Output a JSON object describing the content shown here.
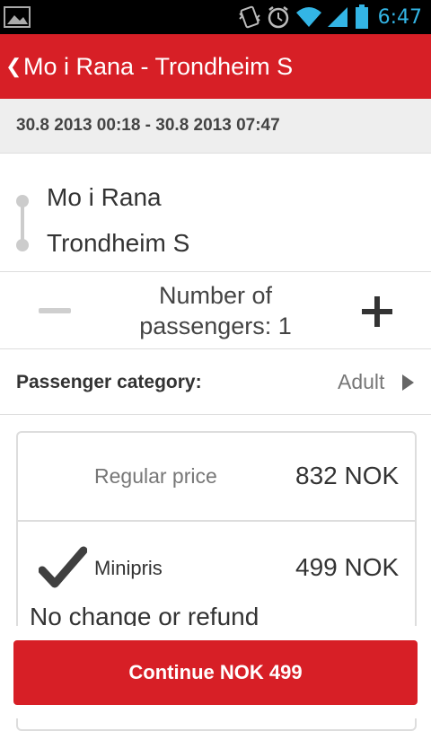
{
  "status_bar": {
    "time": "6:47",
    "icons": [
      "image-icon",
      "vibrate-icon",
      "alarm-icon",
      "wifi-icon",
      "signal-icon",
      "battery-icon"
    ]
  },
  "header": {
    "back_icon": "chevron-left-icon",
    "title": "Mo i Rana - Trondheim S"
  },
  "trip": {
    "date_range": "30.8 2013 00:18 - 30.8 2013 07:47",
    "from": "Mo i Rana",
    "to": "Trondheim S"
  },
  "passengers": {
    "label_line1": "Number of",
    "label_line2": "passengers: 1"
  },
  "category": {
    "label": "Passenger category:",
    "value": "Adult"
  },
  "prices": {
    "regular_label": "Regular price",
    "regular_price": "832 NOK",
    "minipris_label": "Minipris",
    "minipris_price": "499 NOK",
    "minipris_note": "No change or refund"
  },
  "footer": {
    "continue_label": "Continue NOK 499"
  },
  "colors": {
    "accent": "#d71f26",
    "status_blue": "#33b5e5"
  }
}
